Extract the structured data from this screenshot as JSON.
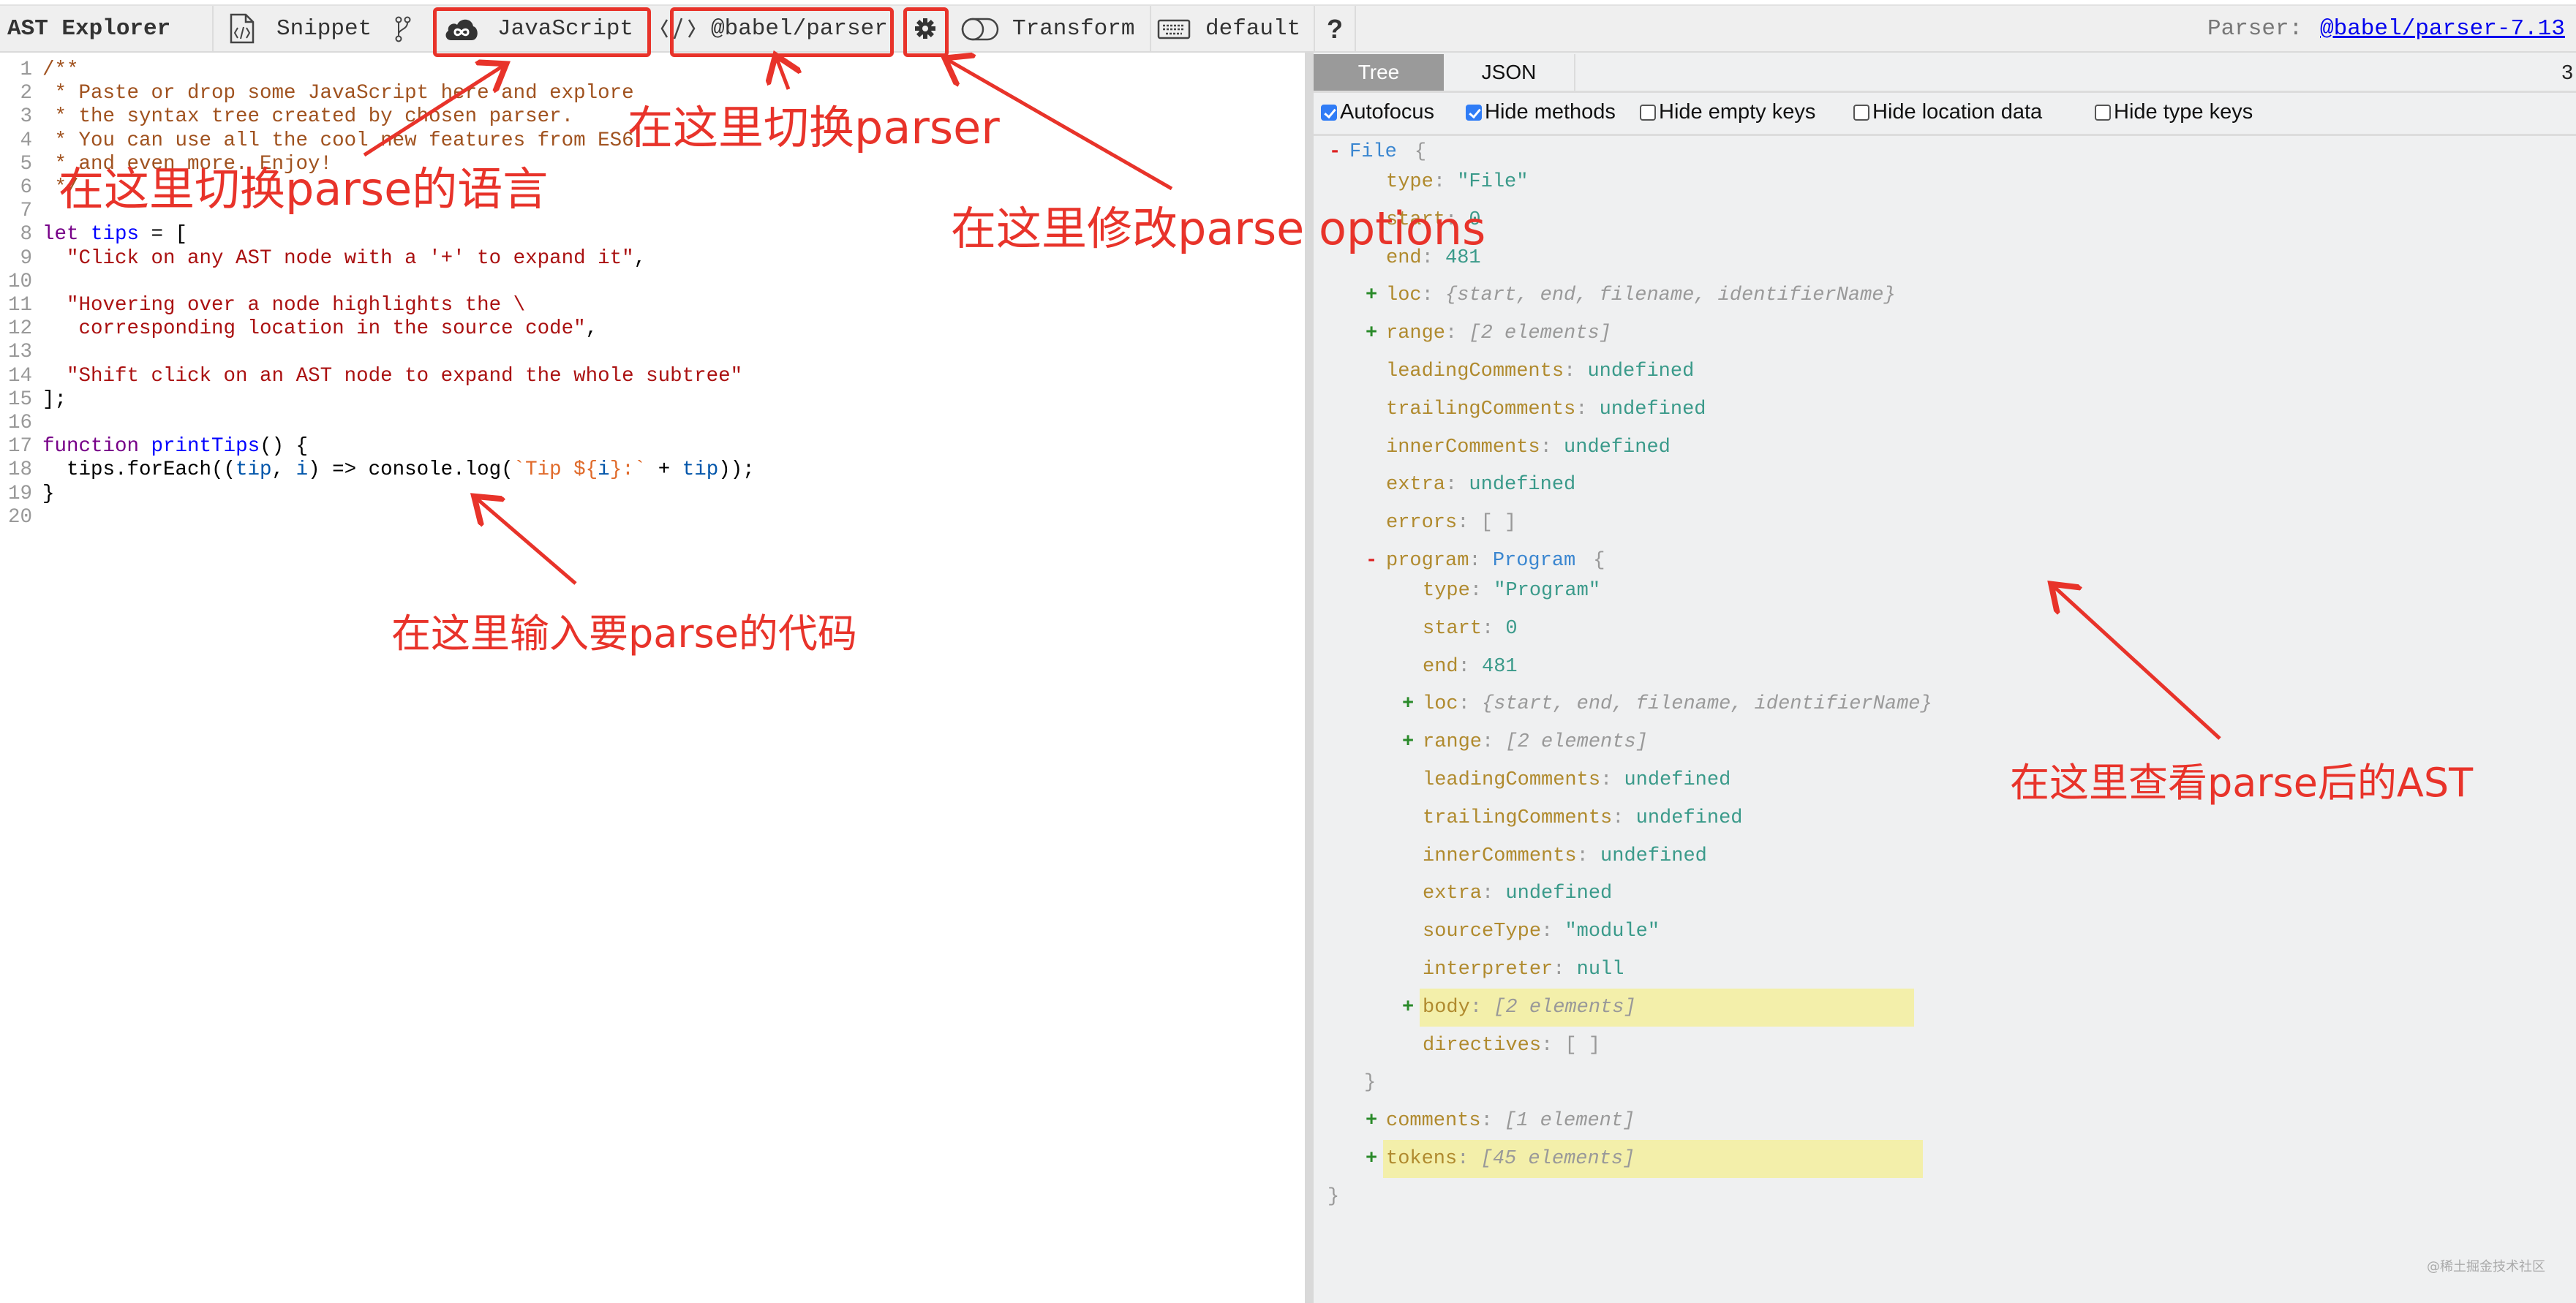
{
  "toolbar": {
    "app_title": "AST Explorer",
    "snippet_label": "Snippet",
    "language_label": "JavaScript",
    "parser_label": "@babel/parser",
    "transform_label": "Transform",
    "keymap_label": "default",
    "help_label": "?",
    "parser_prefix": "Parser:",
    "parser_version_link": "@babel/parser-7.13"
  },
  "editor": {
    "lines": [
      {
        "n": "1",
        "tokens": [
          {
            "t": "/**",
            "c": "com"
          }
        ]
      },
      {
        "n": "2",
        "tokens": [
          {
            "t": " * Paste or drop some JavaScript here and explore",
            "c": "com"
          }
        ]
      },
      {
        "n": "3",
        "tokens": [
          {
            "t": " * the syntax tree created by chosen parser.",
            "c": "com"
          }
        ]
      },
      {
        "n": "4",
        "tokens": [
          {
            "t": " * You can use all the cool new features from ES6",
            "c": "com"
          }
        ]
      },
      {
        "n": "5",
        "tokens": [
          {
            "t": " * and even more. Enjoy!",
            "c": "com"
          }
        ]
      },
      {
        "n": "6",
        "tokens": [
          {
            "t": " */",
            "c": "com"
          }
        ]
      },
      {
        "n": "7",
        "tokens": []
      },
      {
        "n": "8",
        "tokens": [
          {
            "t": "let",
            "c": "kw"
          },
          {
            "t": " ",
            "c": ""
          },
          {
            "t": "tips",
            "c": "def"
          },
          {
            "t": " = [",
            "c": ""
          }
        ]
      },
      {
        "n": "9",
        "tokens": [
          {
            "t": "  ",
            "c": ""
          },
          {
            "t": "\"Click on any AST node with a '+' to expand it\"",
            "c": "str"
          },
          {
            "t": ",",
            "c": ""
          }
        ]
      },
      {
        "n": "10",
        "tokens": []
      },
      {
        "n": "11",
        "tokens": [
          {
            "t": "  ",
            "c": ""
          },
          {
            "t": "\"Hovering over a node highlights the \\",
            "c": "str"
          }
        ]
      },
      {
        "n": "12",
        "tokens": [
          {
            "t": "   corresponding location in the source code\"",
            "c": "str"
          },
          {
            "t": ",",
            "c": ""
          }
        ]
      },
      {
        "n": "13",
        "tokens": []
      },
      {
        "n": "14",
        "tokens": [
          {
            "t": "  ",
            "c": ""
          },
          {
            "t": "\"Shift click on an AST node to expand the whole subtree\"",
            "c": "str"
          }
        ]
      },
      {
        "n": "15",
        "tokens": [
          {
            "t": "];",
            "c": ""
          }
        ]
      },
      {
        "n": "16",
        "tokens": []
      },
      {
        "n": "17",
        "tokens": [
          {
            "t": "function",
            "c": "kw"
          },
          {
            "t": " ",
            "c": ""
          },
          {
            "t": "printTips",
            "c": "def"
          },
          {
            "t": "() {",
            "c": ""
          }
        ]
      },
      {
        "n": "18",
        "tokens": [
          {
            "t": "  tips.forEach((",
            "c": ""
          },
          {
            "t": "tip",
            "c": "var"
          },
          {
            "t": ", ",
            "c": ""
          },
          {
            "t": "i",
            "c": "var"
          },
          {
            "t": ") => console.log(",
            "c": ""
          },
          {
            "t": "`Tip ${",
            "c": "tpl"
          },
          {
            "t": "i",
            "c": "var"
          },
          {
            "t": "}:`",
            "c": "tpl"
          },
          {
            "t": " + ",
            "c": ""
          },
          {
            "t": "tip",
            "c": "var"
          },
          {
            "t": "));",
            "c": ""
          }
        ]
      },
      {
        "n": "19",
        "tokens": [
          {
            "t": "}",
            "c": ""
          }
        ]
      },
      {
        "n": "20",
        "tokens": []
      }
    ]
  },
  "output_panel": {
    "tabs": [
      {
        "label": "Tree",
        "active": true
      },
      {
        "label": "JSON",
        "active": false
      }
    ],
    "error_count": "3",
    "options": [
      {
        "label": "Autofocus",
        "checked": true
      },
      {
        "label": "Hide methods",
        "checked": true
      },
      {
        "label": "Hide empty keys",
        "checked": false
      },
      {
        "label": "Hide location data",
        "checked": false
      },
      {
        "label": "Hide type keys",
        "checked": false
      }
    ],
    "tree": [
      {
        "depth": 0,
        "toggle": "-",
        "key": "",
        "value": "File",
        "vtype": "name",
        "suffix": "{"
      },
      {
        "depth": 1,
        "toggle": "",
        "key": "type",
        "value": "\"File\"",
        "vtype": "str"
      },
      {
        "depth": 1,
        "toggle": "",
        "key": "start",
        "value": "0",
        "vtype": "num"
      },
      {
        "depth": 1,
        "toggle": "",
        "key": "end",
        "value": "481",
        "vtype": "num"
      },
      {
        "depth": 1,
        "toggle": "+",
        "key": "loc",
        "value": "{start, end, filename, identifierName}",
        "vtype": "meta"
      },
      {
        "depth": 1,
        "toggle": "+",
        "key": "range",
        "value": "[2 elements]",
        "vtype": "meta"
      },
      {
        "depth": 1,
        "toggle": "",
        "key": "leadingComments",
        "value": "undefined",
        "vtype": "num"
      },
      {
        "depth": 1,
        "toggle": "",
        "key": "trailingComments",
        "value": "undefined",
        "vtype": "num"
      },
      {
        "depth": 1,
        "toggle": "",
        "key": "innerComments",
        "value": "undefined",
        "vtype": "num"
      },
      {
        "depth": 1,
        "toggle": "",
        "key": "extra",
        "value": "undefined",
        "vtype": "num"
      },
      {
        "depth": 1,
        "toggle": "",
        "key": "errors",
        "value": "[ ]",
        "vtype": "brace"
      },
      {
        "depth": 1,
        "toggle": "-",
        "key": "program",
        "value": "Program",
        "vtype": "name",
        "suffix": "{"
      },
      {
        "depth": 2,
        "toggle": "",
        "key": "type",
        "value": "\"Program\"",
        "vtype": "str"
      },
      {
        "depth": 2,
        "toggle": "",
        "key": "start",
        "value": "0",
        "vtype": "num"
      },
      {
        "depth": 2,
        "toggle": "",
        "key": "end",
        "value": "481",
        "vtype": "num"
      },
      {
        "depth": 2,
        "toggle": "+",
        "key": "loc",
        "value": "{start, end, filename, identifierName}",
        "vtype": "meta"
      },
      {
        "depth": 2,
        "toggle": "+",
        "key": "range",
        "value": "[2 elements]",
        "vtype": "meta"
      },
      {
        "depth": 2,
        "toggle": "",
        "key": "leadingComments",
        "value": "undefined",
        "vtype": "num"
      },
      {
        "depth": 2,
        "toggle": "",
        "key": "trailingComments",
        "value": "undefined",
        "vtype": "num"
      },
      {
        "depth": 2,
        "toggle": "",
        "key": "innerComments",
        "value": "undefined",
        "vtype": "num"
      },
      {
        "depth": 2,
        "toggle": "",
        "key": "extra",
        "value": "undefined",
        "vtype": "num"
      },
      {
        "depth": 2,
        "toggle": "",
        "key": "sourceType",
        "value": "\"module\"",
        "vtype": "str"
      },
      {
        "depth": 2,
        "toggle": "",
        "key": "interpreter",
        "value": "null",
        "vtype": "num"
      },
      {
        "depth": 2,
        "toggle": "+",
        "key": "body",
        "value": "[2 elements]",
        "vtype": "meta",
        "highlight": true
      },
      {
        "depth": 2,
        "toggle": "",
        "key": "directives",
        "value": "[ ]",
        "vtype": "brace"
      },
      {
        "depth": 1,
        "toggle": "",
        "key": "",
        "value": "}",
        "vtype": "brace",
        "closing": true
      },
      {
        "depth": 1,
        "toggle": "+",
        "key": "comments",
        "value": "[1 element]",
        "vtype": "meta"
      },
      {
        "depth": 1,
        "toggle": "+",
        "key": "tokens",
        "value": "[45 elements]",
        "vtype": "meta",
        "highlight": true
      },
      {
        "depth": 0,
        "toggle": "",
        "key": "",
        "value": "}",
        "vtype": "brace",
        "closing": true
      }
    ]
  },
  "annotations": {
    "language_note": "在这里切换parse的语言",
    "parser_note": "在这里切换parser",
    "options_note": "在这里修改parse options",
    "code_note": "在这里输入要parse的代码",
    "ast_note": "在这里查看parse后的AST",
    "color": "#e8332a"
  },
  "watermark": "@稀土掘金技术社区"
}
